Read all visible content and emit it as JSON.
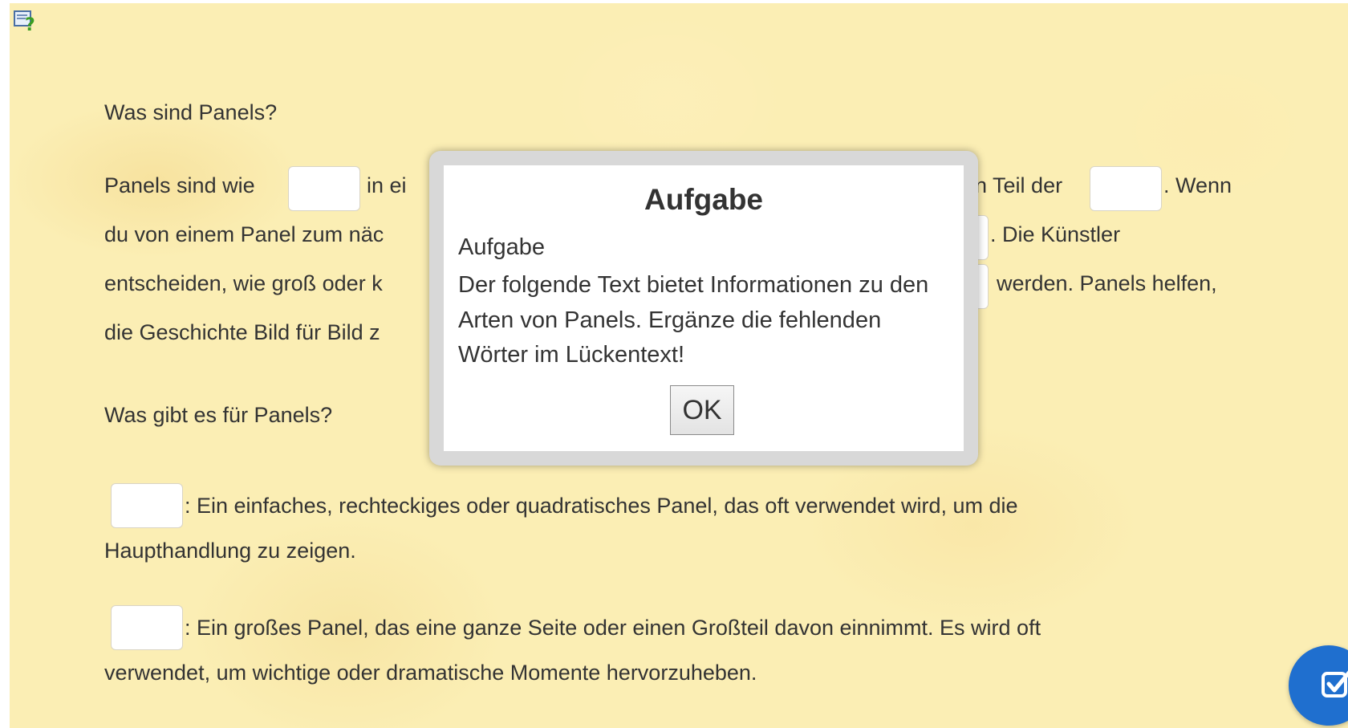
{
  "content": {
    "heading_1": "Was sind Panels?",
    "para1": {
      "line1_a": "Panels sind wie",
      "line1_b": "in ei",
      "line1_c": "en Teil der",
      "line1_d": ". Wenn",
      "line2_a": "du von einem Panel zum näc",
      "line2_b": ". Die Künstler",
      "line3_a": "entscheiden, wie groß oder k",
      "line3_b": "werden. Panels helfen,",
      "line4_a": "die Geschichte Bild für Bild z"
    },
    "heading_2": "Was gibt es für Panels?",
    "item1": {
      "line1": ": Ein einfaches, rechteckiges oder quadratisches Panel, das oft verwendet wird, um die",
      "line2": "Haupthandlung zu zeigen."
    },
    "item2": {
      "line1": ": Ein großes Panel, das eine ganze Seite oder einen Großteil davon einnimmt. Es wird oft",
      "line2": "verwendet, um wichtige oder dramatische Momente hervorzuheben."
    }
  },
  "modal": {
    "title": "Aufgabe",
    "heading": "Aufgabe",
    "body": "Der folgende Text bietet Informationen zu den Arten von Panels. Ergänze die fehlenden Wörter im Lückentext!",
    "ok_label": "OK"
  },
  "icons": {
    "help": "help-question-icon",
    "check": "check-submit-icon"
  },
  "colors": {
    "background": "#fbeeb4",
    "text": "#333333",
    "check_button": "#1f6fcf"
  }
}
